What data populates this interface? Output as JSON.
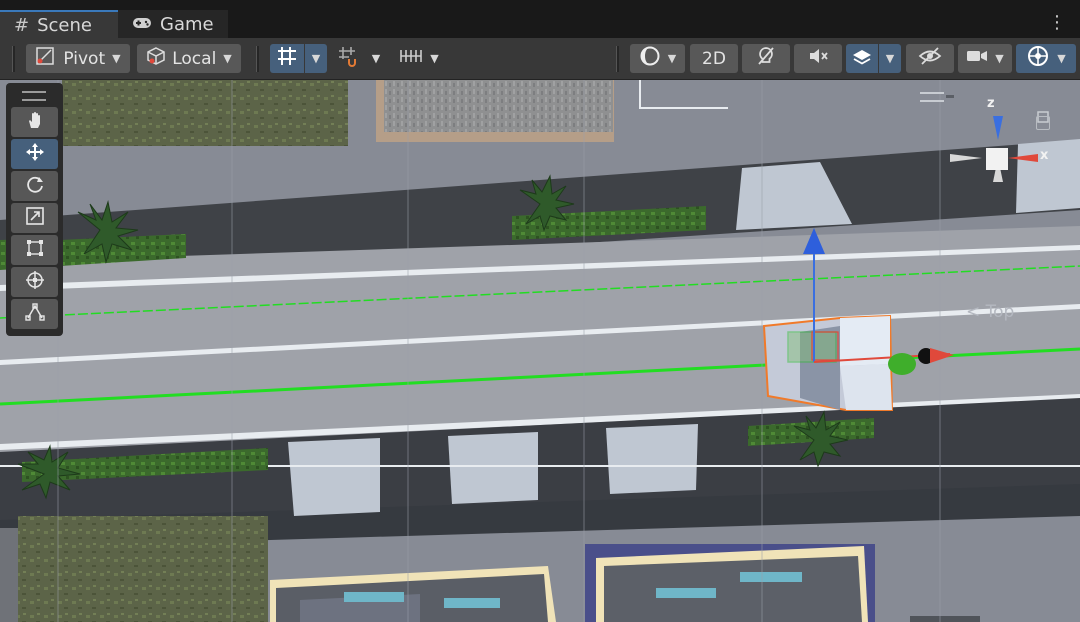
{
  "tabs": [
    {
      "label": "Scene",
      "icon": "hash-icon",
      "active": true
    },
    {
      "label": "Game",
      "icon": "gamepad-icon",
      "active": false
    }
  ],
  "toolbar": {
    "pivot_label": "Pivot",
    "local_label": "Local",
    "mode_2d_label": "2D"
  },
  "tools": [
    {
      "name": "hand-tool",
      "active": false
    },
    {
      "name": "move-tool",
      "active": true
    },
    {
      "name": "rotate-tool",
      "active": false
    },
    {
      "name": "scale-tool",
      "active": false
    },
    {
      "name": "rect-tool",
      "active": false
    },
    {
      "name": "transform-tool",
      "active": false
    },
    {
      "name": "custom-editor-tool",
      "active": false
    }
  ],
  "gizmo": {
    "view_label": "Top",
    "axis_y_label": "z",
    "axis_x_label": "x"
  },
  "colors": {
    "accent": "#46607c",
    "tab_underline": "#3a79bb",
    "axis_x": "#e0493b",
    "axis_z": "#3a6fe0",
    "axis_y": "#3fae2b",
    "selection_outline": "#f07a2a",
    "path_line": "#22dd22"
  }
}
